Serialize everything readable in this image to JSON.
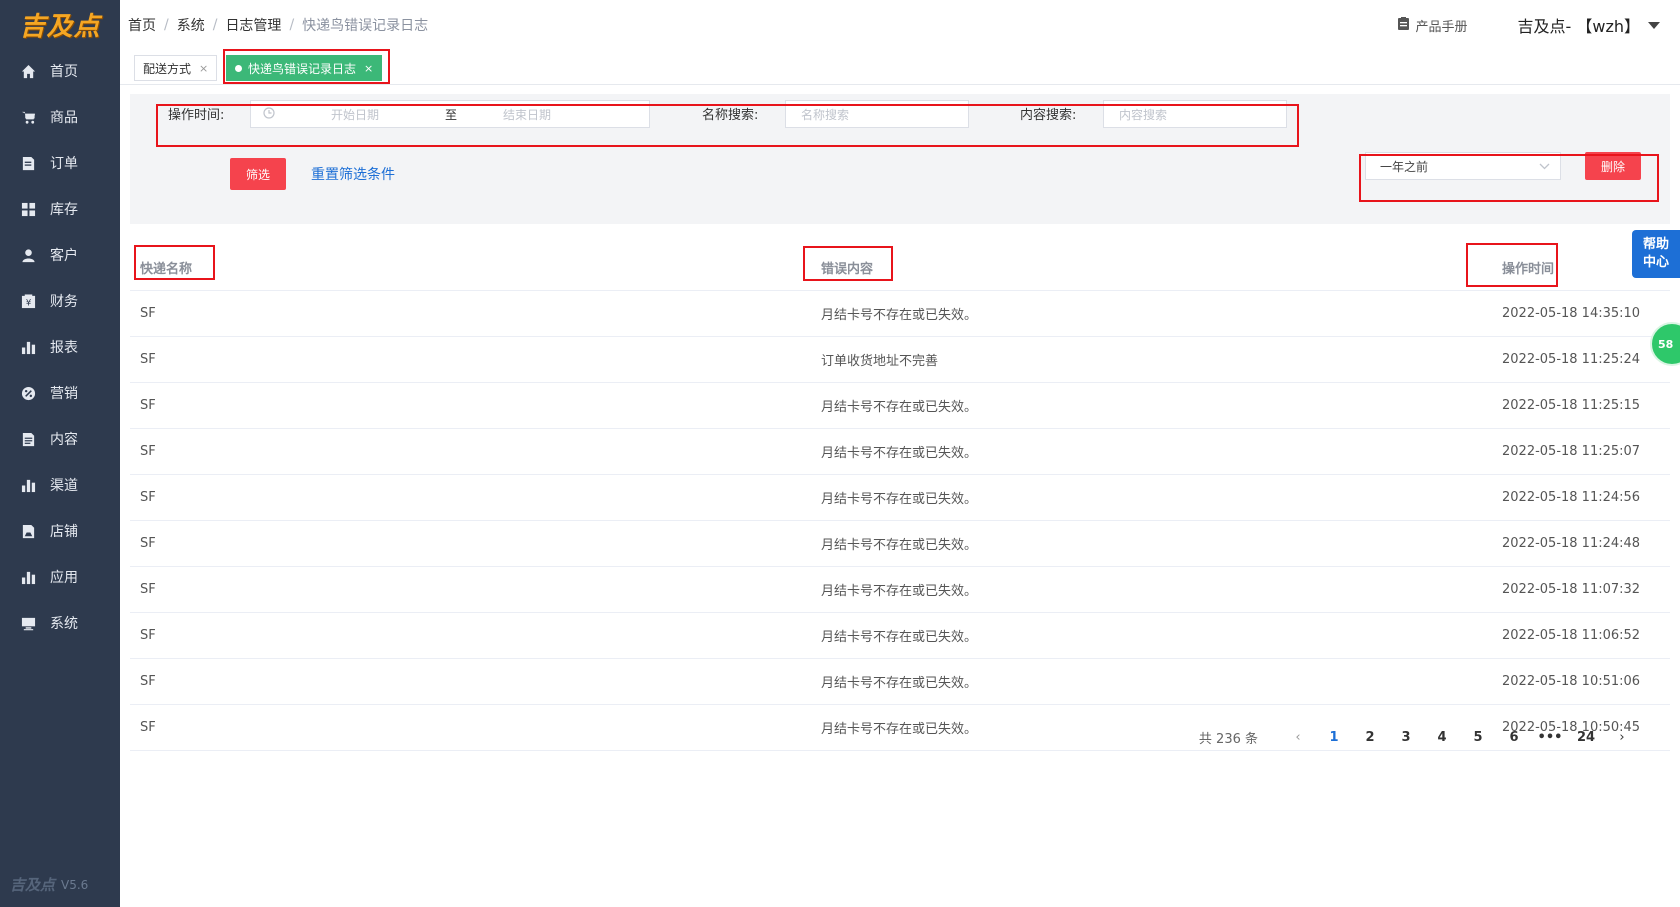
{
  "brand": {
    "logo_text": "吉及点",
    "version": "V5.6"
  },
  "sidebar": {
    "items": [
      {
        "label": "首页",
        "icon": "home-icon"
      },
      {
        "label": "商品",
        "icon": "cart-icon"
      },
      {
        "label": "订单",
        "icon": "order-icon"
      },
      {
        "label": "库存",
        "icon": "grid-icon"
      },
      {
        "label": "客户",
        "icon": "user-icon"
      },
      {
        "label": "财务",
        "icon": "finance-icon"
      },
      {
        "label": "报表",
        "icon": "bar-chart-icon"
      },
      {
        "label": "营销",
        "icon": "percent-icon"
      },
      {
        "label": "内容",
        "icon": "doc-icon"
      },
      {
        "label": "渠道",
        "icon": "bar-chart-icon"
      },
      {
        "label": "店铺",
        "icon": "store-icon"
      },
      {
        "label": "应用",
        "icon": "bar-chart-icon"
      },
      {
        "label": "系统",
        "icon": "monitor-icon"
      }
    ]
  },
  "breadcrumb": [
    "首页",
    "系统",
    "日志管理",
    "快递鸟错误记录日志"
  ],
  "header": {
    "manual_label": "产品手册",
    "user_label": "吉及点-  【wzh】"
  },
  "tabs": [
    {
      "label": "配送方式",
      "active": false
    },
    {
      "label": "快递鸟错误记录日志",
      "active": true
    }
  ],
  "filters": {
    "time_label": "操作时间:",
    "start_placeholder": "开始日期",
    "range_sep": "至",
    "end_placeholder": "结束日期",
    "name_label": "名称搜索:",
    "name_placeholder": "名称搜索",
    "content_label": "内容搜索:",
    "content_placeholder": "内容搜索",
    "filter_button": "筛选",
    "reset_link": "重置筛选条件",
    "range_select_value": "一年之前",
    "delete_button": "删除"
  },
  "table": {
    "headers": [
      "快递名称",
      "错误内容",
      "操作时间"
    ],
    "rows": [
      [
        "SF",
        "月结卡号不存在或已失效。",
        "2022-05-18 14:35:10"
      ],
      [
        "SF",
        "订单收货地址不完善",
        "2022-05-18 11:25:24"
      ],
      [
        "SF",
        "月结卡号不存在或已失效。",
        "2022-05-18 11:25:15"
      ],
      [
        "SF",
        "月结卡号不存在或已失效。",
        "2022-05-18 11:25:07"
      ],
      [
        "SF",
        "月结卡号不存在或已失效。",
        "2022-05-18 11:24:56"
      ],
      [
        "SF",
        "月结卡号不存在或已失效。",
        "2022-05-18 11:24:48"
      ],
      [
        "SF",
        "月结卡号不存在或已失效。",
        "2022-05-18 11:07:32"
      ],
      [
        "SF",
        "月结卡号不存在或已失效。",
        "2022-05-18 11:06:52"
      ],
      [
        "SF",
        "月结卡号不存在或已失效。",
        "2022-05-18 10:51:06"
      ],
      [
        "SF",
        "月结卡号不存在或已失效。",
        "2022-05-18 10:50:45"
      ]
    ]
  },
  "pagination": {
    "total_label": "共 236 条",
    "pages": [
      "1",
      "2",
      "3",
      "4",
      "5",
      "6",
      "•••",
      "24"
    ],
    "current": "1"
  },
  "help": {
    "line1": "帮助",
    "line2": "中心"
  },
  "bubble": {
    "count": "58"
  },
  "colors": {
    "sidebar_bg": "#2e3a4e",
    "accent_green": "#3cb878",
    "danger_red": "#f5434d",
    "link_blue": "#1d6fd6",
    "highlight_box": "#e8141b"
  }
}
